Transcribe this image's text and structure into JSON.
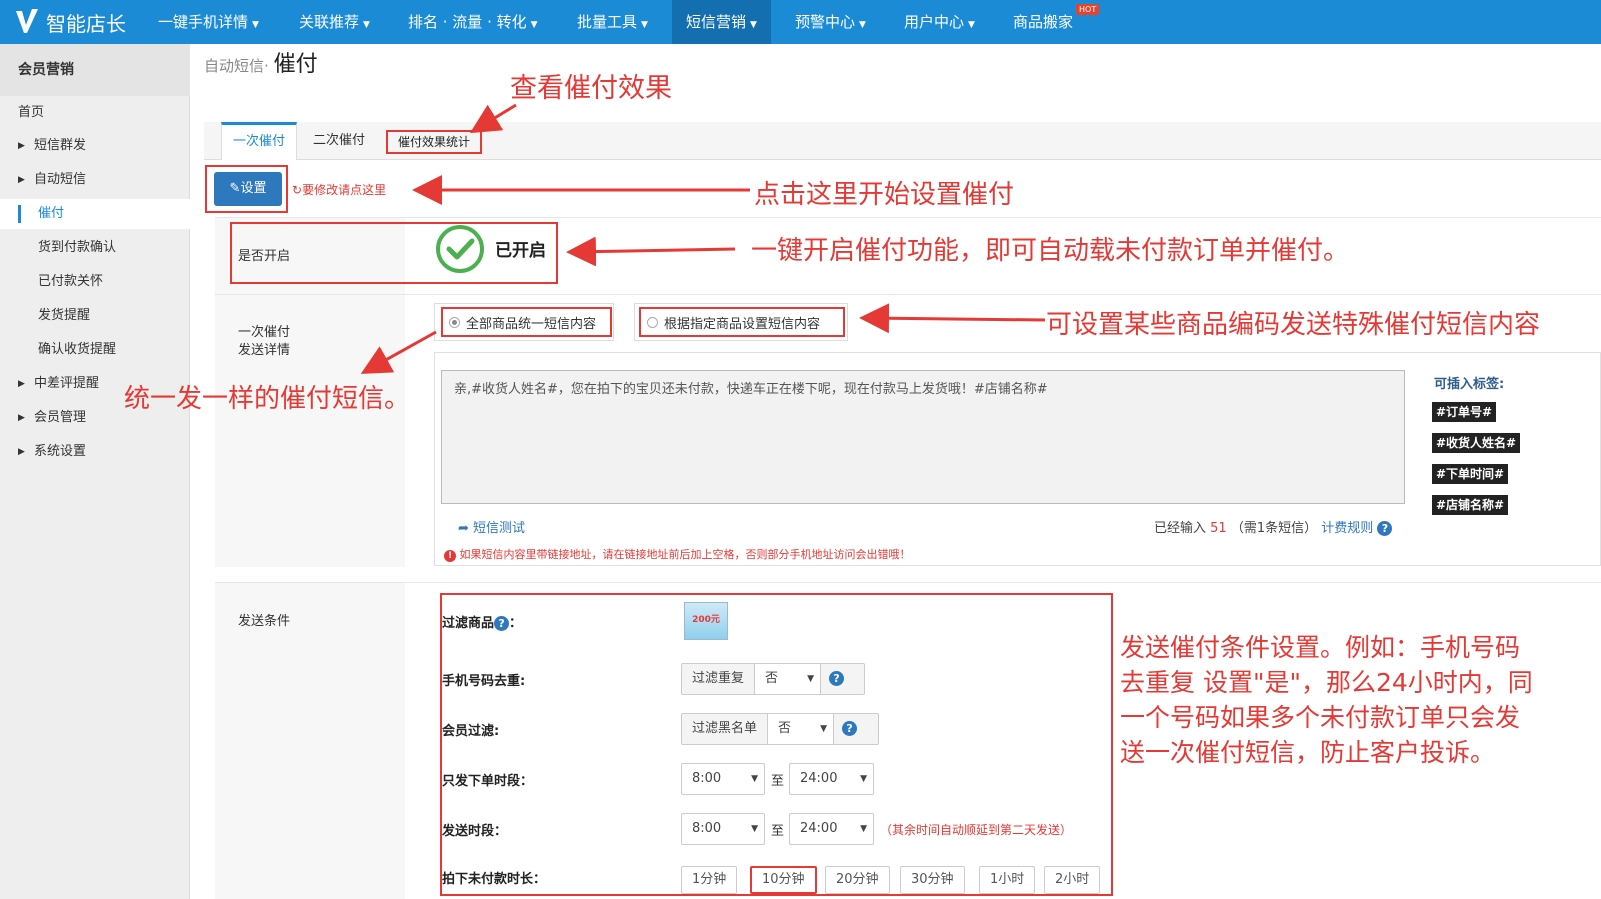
{
  "topbar": {
    "logo_text": "智能店长",
    "nav": [
      "一键手机详情",
      "关联推荐",
      "排名 · 流量 · 转化",
      "批量工具",
      "短信营销",
      "预警中心",
      "用户中心",
      "商品搬家"
    ],
    "hot_badge": "HOT",
    "accent_color": "#1b8bd6"
  },
  "sidebar": {
    "title": "会员营销",
    "items": [
      "首页",
      "短信群发",
      "自动短信",
      "催付",
      "货到付款确认",
      "已付款关怀",
      "发货提醒",
      "确认收货提醒",
      "中差评提醒",
      "会员管理",
      "系统设置"
    ]
  },
  "breadcrumb": {
    "parent": "自动短信·",
    "current": "催付"
  },
  "tabs": {
    "first": "一次催付",
    "second": "二次催付",
    "stats": "催付效果统计"
  },
  "settings": {
    "button_label": "设置",
    "modify_hint": "要修改请点这里",
    "enabled_label": "是否开启",
    "enabled_status": "已开启"
  },
  "detail": {
    "label_line1": "一次催付",
    "label_line2": "发送详情",
    "radio_all": "全部商品统一短信内容",
    "radio_specific": "根据指定商品设置短信内容",
    "sms_text": "亲,#收货人姓名#，您在拍下的宝贝还未付款，快递车正在楼下呢，现在付款马上发货哦！#店铺名称#",
    "insert_tags_label": "可插入标签:",
    "tags": [
      "#订单号#",
      "#收货人姓名#",
      "#下单时间#",
      "#店铺名称#"
    ],
    "sms_test": "短信测试",
    "count_prefix": "已经输入",
    "count_value": "51",
    "count_suffix": "（需",
    "sms_count": "1",
    "count_unit": "条短信）",
    "fee_rule": "计费规则",
    "warning": "如果短信内容里带链接地址，请在链接地址前后加上空格，否则部分手机地址访问会出错哦！"
  },
  "conditions": {
    "label": "发送条件",
    "filter_goods": "过滤商品",
    "phone_dedupe": "手机号码去重:",
    "phone_filter_btn": "过滤重复",
    "phone_value": "否",
    "member_filter": "会员过滤:",
    "member_filter_btn": "过滤黑名单",
    "member_value": "否",
    "order_period": "只发下单时段：",
    "order_from": "8:00",
    "order_to": "24:00",
    "to_word": "至",
    "send_period": "发送时段：",
    "send_from": "8:00",
    "send_to": "24:00",
    "send_note": "（其余时间自动顺延到第二天发送）",
    "unpaid_duration": "拍下未付款时长：",
    "durations": [
      "1分钟",
      "10分钟",
      "20分钟",
      "30分钟",
      "1小时",
      "2小时"
    ],
    "selected_duration": "10分钟",
    "promo_image_text": "200元"
  },
  "annotations": {
    "view_effect": "查看催付效果",
    "click_setup": "点击这里开始设置催付",
    "one_click": "一键开启催付功能，即可自动载未付款订单并催付。",
    "special_content": "可设置某些商品编码发送特殊催付短信内容",
    "same_sms": "统一发一样的催付短信。",
    "condition_line1": "发送催付条件设置。例如：手机号码",
    "condition_line2": "去重复 设置\"是\"，那么24小时内，同",
    "condition_line3": "一个号码如果多个未付款订单只会发",
    "condition_line4": "送一次催付短信，防止客户投诉。"
  }
}
